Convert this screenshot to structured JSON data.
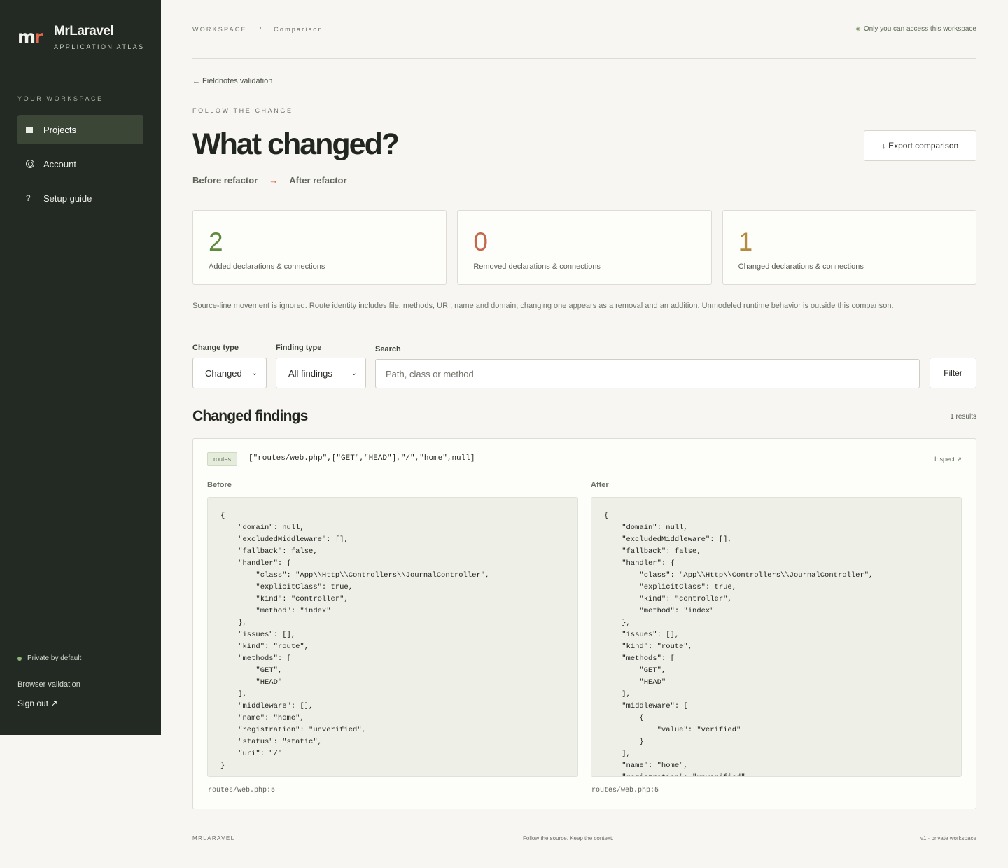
{
  "sidebar": {
    "brand_logo_m": "m",
    "brand_logo_r": "r",
    "brand_name": "MrLaravel",
    "brand_sub": "APPLICATION ATLAS",
    "workspace_label": "YOUR WORKSPACE",
    "nav": [
      {
        "label": "Projects",
        "icon": "square-icon",
        "active": true
      },
      {
        "label": "Account",
        "icon": "ring-icon",
        "active": false
      },
      {
        "label": "Setup guide",
        "icon": "question-icon",
        "active": false
      }
    ],
    "question_glyph": "?",
    "private_label": "Private by default",
    "browser_validation": "Browser validation",
    "sign_out": "Sign out ↗"
  },
  "header": {
    "crumb_workspace": "WORKSPACE",
    "crumb_sep": "/",
    "crumb_page": "Comparison",
    "access": "Only you can access this workspace",
    "access_icon": "◈"
  },
  "page": {
    "back_link": "← Fieldnotes validation",
    "eyebrow": "FOLLOW THE CHANGE",
    "title": "What changed?",
    "export_label": "↓ Export comparison",
    "before_version": "Before refactor",
    "arrow": "→",
    "after_version": "After refactor"
  },
  "stats": [
    {
      "value": "2",
      "label": "Added declarations & connections",
      "color": "#5f8a3f"
    },
    {
      "value": "0",
      "label": "Removed declarations & connections",
      "color": "#c4674c"
    },
    {
      "value": "1",
      "label": "Changed declarations & connections",
      "color": "#b48b3e"
    }
  ],
  "note": "Source-line movement is ignored. Route identity includes file, methods, URI, name and domain; changing one appears as a removal and an addition. Unmodeled runtime behavior is outside this comparison.",
  "filters": {
    "change_type_label": "Change type",
    "change_type_value": "Changed",
    "finding_type_label": "Finding type",
    "finding_type_value": "All findings",
    "search_label": "Search",
    "search_placeholder": "Path, class or method",
    "filter_button": "Filter",
    "chevron": "⌄"
  },
  "findings": {
    "title": "Changed findings",
    "results": "1 results",
    "item": {
      "tag": "routes",
      "key": "[\"routes/web.php\",[\"GET\",\"HEAD\"],\"/\",\"home\",null]",
      "inspect": "Inspect ↗",
      "before_label": "Before",
      "after_label": "After",
      "before_code": "{\n    \"domain\": null,\n    \"excludedMiddleware\": [],\n    \"fallback\": false,\n    \"handler\": {\n        \"class\": \"App\\\\Http\\\\Controllers\\\\JournalController\",\n        \"explicitClass\": true,\n        \"kind\": \"controller\",\n        \"method\": \"index\"\n    },\n    \"issues\": [],\n    \"kind\": \"route\",\n    \"methods\": [\n        \"GET\",\n        \"HEAD\"\n    ],\n    \"middleware\": [],\n    \"name\": \"home\",\n    \"registration\": \"unverified\",\n    \"status\": \"static\",\n    \"uri\": \"/\"\n}",
      "after_code": "{\n    \"domain\": null,\n    \"excludedMiddleware\": [],\n    \"fallback\": false,\n    \"handler\": {\n        \"class\": \"App\\\\Http\\\\Controllers\\\\JournalController\",\n        \"explicitClass\": true,\n        \"kind\": \"controller\",\n        \"method\": \"index\"\n    },\n    \"issues\": [],\n    \"kind\": \"route\",\n    \"methods\": [\n        \"GET\",\n        \"HEAD\"\n    ],\n    \"middleware\": [\n        {\n            \"value\": \"verified\"\n        }\n    ],\n    \"name\": \"home\",\n    \"registration\": \"unverified\",\n    \"status\": \"static\",\n    \"uri\": \"/\"\n}",
      "before_location": "routes/web.php:5",
      "after_location": "routes/web.php:5"
    }
  },
  "footer": {
    "left": "MRLARAVEL",
    "center": "Follow the source. Keep the context.",
    "right": "v1 · private workspace"
  }
}
